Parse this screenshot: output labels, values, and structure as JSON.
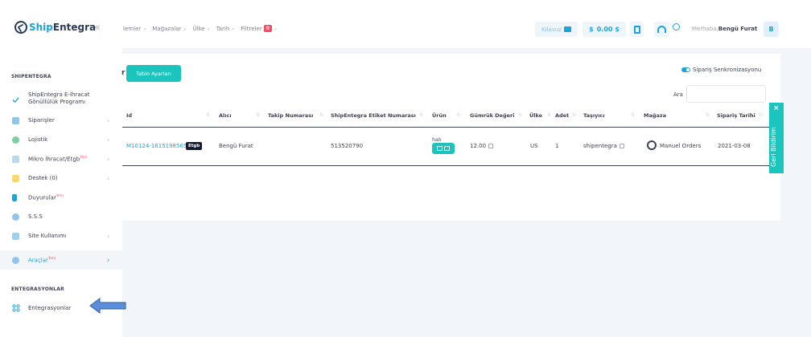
{
  "header": {
    "logo_ship": "Ship",
    "logo_entegra": "Entegra",
    "collapse": "«",
    "nav": [
      {
        "label": "İşlemler"
      },
      {
        "label": "Mağazalar"
      },
      {
        "label": "Ülke"
      },
      {
        "label": "Tarih"
      },
      {
        "label": "Filtreler"
      }
    ],
    "nav_first_visible": "lemler",
    "filter_count": "0",
    "kilavuz": "Kılavuz",
    "balance": "0.00 $",
    "greeting_prefix": "Merhaba,",
    "user_name": "Bengü Furat",
    "avatar_letter": "B"
  },
  "sidebar": {
    "section1": "SHIPENTEGRA",
    "items": [
      {
        "label": "ShipEntegra E-İhracat Gönüllülük Programı",
        "icon": "check-icon",
        "badge": ""
      },
      {
        "label": "Siparişler",
        "icon": "cart-icon",
        "badge": ""
      },
      {
        "label": "Lojistik",
        "icon": "logistics-icon",
        "badge": ""
      },
      {
        "label": "Mikro İhracat/Etgb",
        "icon": "clipboard-icon",
        "badge": "Yeni"
      },
      {
        "label": "Destek (0)",
        "icon": "clipboard-yellow-icon",
        "badge": ""
      },
      {
        "label": "Duyurular",
        "icon": "megaphone-icon",
        "badge": "Yeni"
      },
      {
        "label": "S.S.S",
        "icon": "question-icon",
        "badge": ""
      },
      {
        "label": "Site Kullanımı",
        "icon": "usage-icon",
        "badge": ""
      },
      {
        "label": "Araçlar",
        "icon": "tools-icon",
        "badge": "Yeni"
      }
    ],
    "section2": "ENTEGRASYONLAR",
    "integrations_label": "Entegrasyonlar"
  },
  "card": {
    "tablo_button": "Tablo Ayarları",
    "stub_char": "r",
    "sync_label": "Sipariş Senkronizasyonu",
    "search_label": "Ara",
    "search_value": ""
  },
  "table": {
    "columns": [
      "Id",
      "Alıcı",
      "Takip Numarası",
      "ShipEntegra Etiket Numarası",
      "Ürün",
      "Gümrük Değeri",
      "Ülke",
      "Adet",
      "Taşıyıcı",
      "Mağaza",
      "Sipariş Tarihi"
    ],
    "rows": [
      {
        "id": "M10124-1615198565",
        "etgb": "Etgb",
        "alici": "Bengü Furat",
        "takip": "",
        "etiket": "513520790",
        "urun": "halı",
        "gumruk": "12.00",
        "ulke": "US",
        "adet": "1",
        "tasiyici": "shipentegra",
        "magaza": "Manuel Orders",
        "tarih": "2021-03-08"
      }
    ]
  },
  "feedback": {
    "label": "Geri Bildirim",
    "close": "×"
  },
  "colors": {
    "accent": "#1ea3d8",
    "teal": "#1bc5bd",
    "danger": "#f64e60",
    "arrow": "#5b8dd9"
  }
}
